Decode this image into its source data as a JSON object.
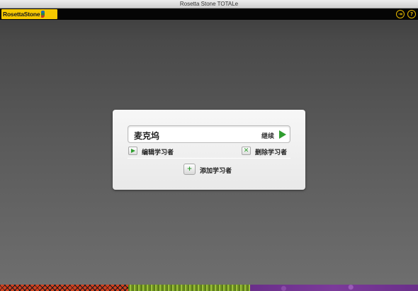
{
  "window": {
    "title": "Rosetta Stone TOTALe"
  },
  "header": {
    "logo_text": "RosettaStone",
    "exit_icon": "exit-icon",
    "help_icon": "help-icon",
    "help_glyph": "?",
    "exit_glyph": "⇥",
    "accent_color": "#e6b800",
    "logo_color": "#f5c800"
  },
  "login": {
    "learner_name": "麦克坞",
    "continue_label": "继续",
    "edit_label": "编辑学习者",
    "delete_label": "删除学习者",
    "add_label": "添加学习者",
    "action_color": "#2f9e2f"
  }
}
